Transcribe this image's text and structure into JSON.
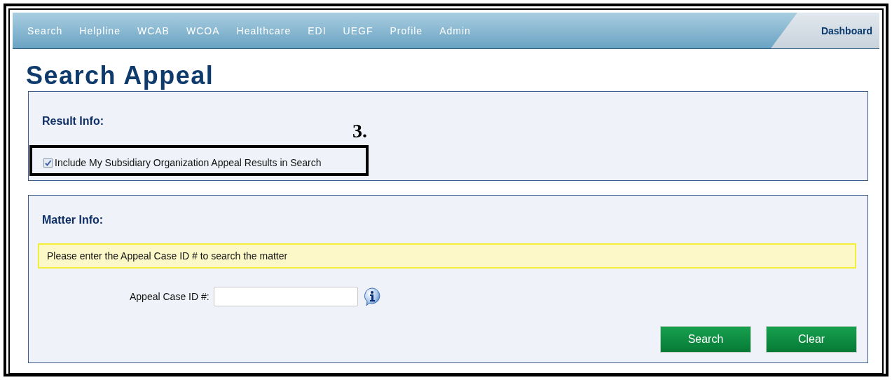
{
  "nav": {
    "items": [
      {
        "label": "Search"
      },
      {
        "label": "Helpline"
      },
      {
        "label": "WCAB"
      },
      {
        "label": "WCOA"
      },
      {
        "label": "Healthcare"
      },
      {
        "label": "EDI"
      },
      {
        "label": "UEGF"
      },
      {
        "label": "Profile"
      },
      {
        "label": "Admin"
      }
    ],
    "dashboard": "Dashboard"
  },
  "page_title": "Search Appeal",
  "result_info": {
    "heading": "Result Info:",
    "annotation": "3.",
    "checkbox": {
      "label": "Include My Subsidiary Organization Appeal Results in Search",
      "checked": true
    }
  },
  "matter_info": {
    "heading": "Matter Info:",
    "notice": "Please enter the Appeal Case ID # to search the matter",
    "field": {
      "label": "Appeal Case ID #:"
    }
  },
  "buttons": [
    {
      "label": "Search"
    },
    {
      "label": "Clear"
    }
  ]
}
